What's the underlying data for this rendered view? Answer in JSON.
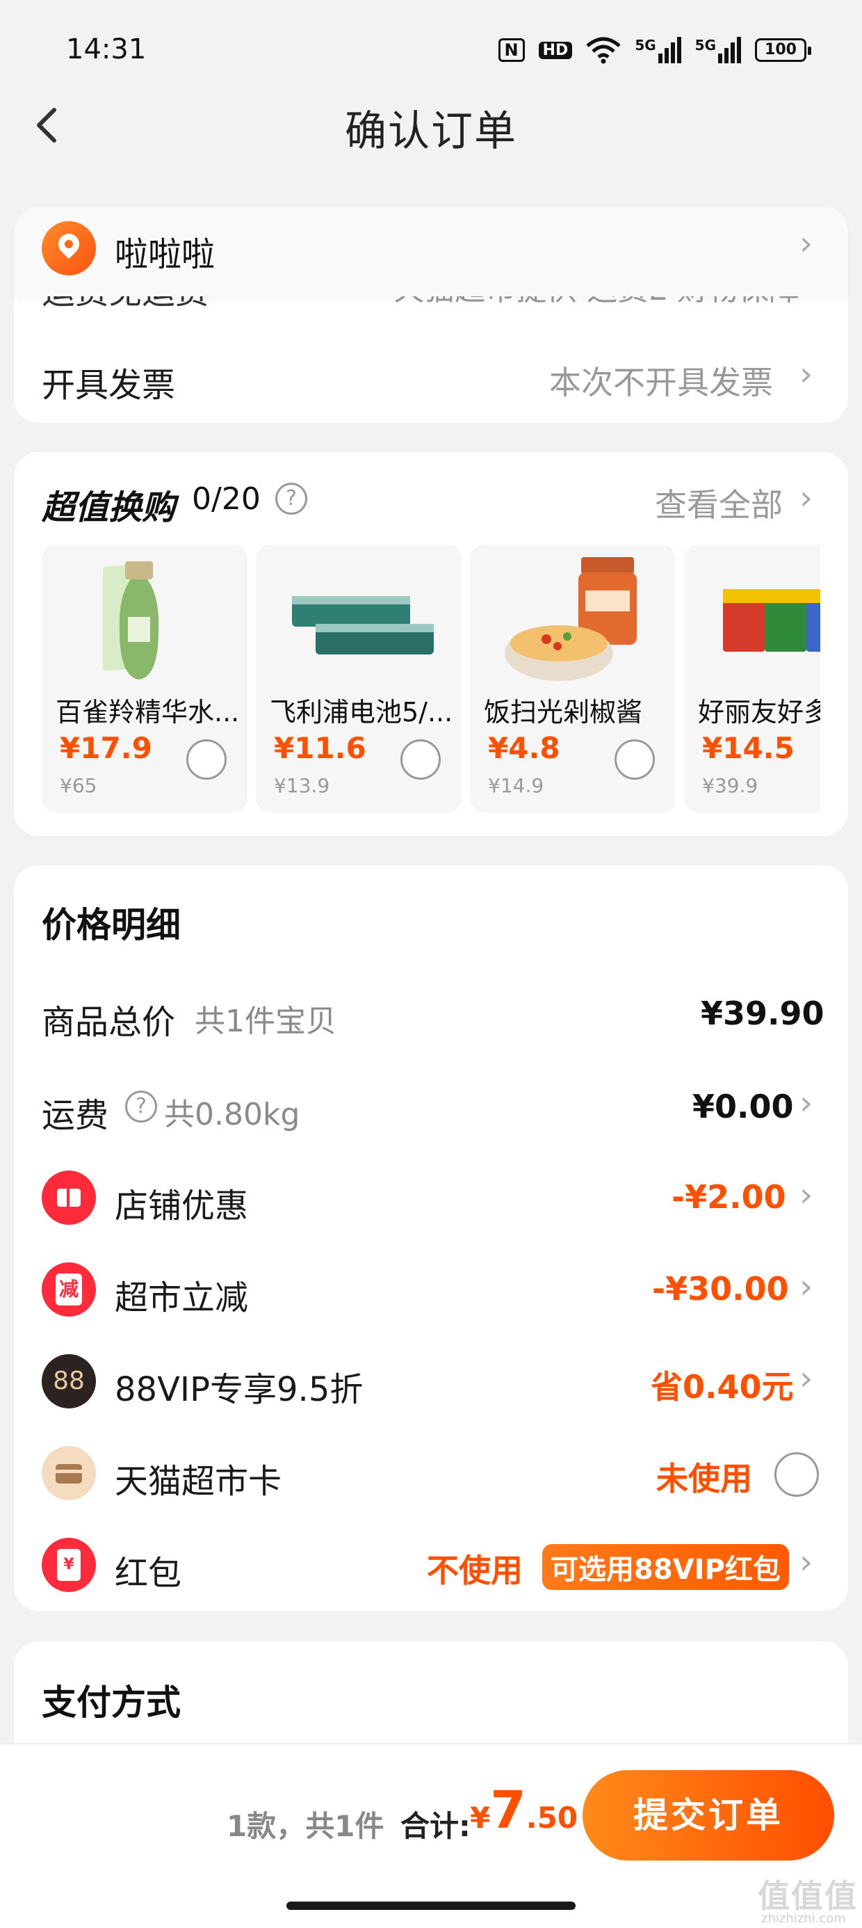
{
  "status_bar": {
    "time": "14:31",
    "nfc": "N",
    "hd": "HD",
    "wifi": "WiFi",
    "sig1": "5G",
    "sig2": "5G",
    "battery": "100"
  },
  "nav": {
    "title": "确认订单"
  },
  "address": {
    "name": "啦啦啦"
  },
  "shipping": {
    "label_partial": "运费免运费",
    "value_partial": "天猫超市提供 运费E 财物保障"
  },
  "invoice": {
    "label": "开具发票",
    "value": "本次不开具发票"
  },
  "exchange": {
    "title": "超值换购",
    "count": "0/20",
    "view_all": "查看全部",
    "products": [
      {
        "name": "百雀羚精华水...",
        "price": "¥17.9",
        "orig": "¥65"
      },
      {
        "name": "飞利浦电池5/...",
        "price": "¥11.6",
        "orig": "¥13.9"
      },
      {
        "name": "饭扫光剁椒酱",
        "price": "¥4.8",
        "orig": "¥14.9"
      },
      {
        "name": "好丽友好多",
        "price": "¥14.5",
        "orig": "¥39.9"
      }
    ]
  },
  "price_detail": {
    "title": "价格明细",
    "total": {
      "label": "商品总价",
      "sub": "共1件宝贝",
      "value": "¥39.90"
    },
    "freight": {
      "label": "运费",
      "sub": "共0.80kg",
      "value": "¥0.00"
    },
    "shop_discount": {
      "label": "店铺优惠",
      "value": "-¥2.00"
    },
    "market_discount": {
      "label": "超市立减",
      "value": "-¥30.00",
      "icon_text": "减"
    },
    "vip": {
      "label": "88VIP专享9.5折",
      "value": "省0.40元",
      "icon_text": "88"
    },
    "card": {
      "label": "天猫超市卡",
      "value": "未使用"
    },
    "redpacket": {
      "label": "红包",
      "value": "不使用",
      "pill": "可选用88VIP红包",
      "icon_text": "¥"
    }
  },
  "payment": {
    "title": "支付方式"
  },
  "footer": {
    "count": "1款，共1件",
    "total_label": "合计:",
    "currency": "¥",
    "int": "7",
    "dec": ".50",
    "submit": "提交订单"
  },
  "watermark": {
    "main": "值值值",
    "sub": "zhizhizhi.com"
  },
  "colors": {
    "accent": "#ff5000",
    "background": "#f2f2f2"
  }
}
